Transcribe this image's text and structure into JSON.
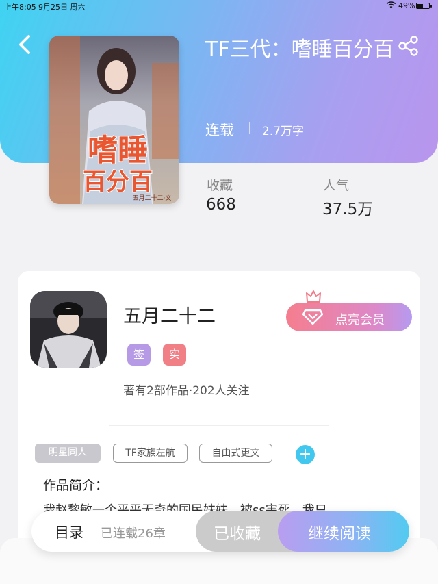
{
  "status_bar": {
    "time": "上午8:05",
    "date": "9月25日 周六",
    "battery": "49%",
    "battery_level": 0.49
  },
  "book": {
    "title": "TF三代：嗜睡百分百",
    "status": "连载",
    "words": "2.7万字",
    "cover_text": "嗜睡百分百",
    "cover_author": "五月二十二·文"
  },
  "stats": {
    "collect_label": "收藏",
    "collect_value": "668",
    "popularity_label": "人气",
    "popularity_value": "37.5万"
  },
  "author": {
    "name": "五月二十二",
    "badges": [
      "签",
      "实"
    ],
    "meta": "著有2部作品·202人关注",
    "vip_button": "点亮会员"
  },
  "tags": [
    "明星同人",
    "TF家族左航",
    "自由式更文"
  ],
  "intro": {
    "title": "作品简介：",
    "text": "我赵黎敏一个平平无奇的国民妹妹，被ss害死，我只"
  },
  "bottom_bar": {
    "toc_label": "目录",
    "toc_count": "已连载26章",
    "collected": "已收藏",
    "continue": "继续阅读"
  },
  "colors": {
    "header_start": "#3fd3f2",
    "header_end": "#b995ee",
    "badge_qian": "#b79ae6",
    "badge_shi": "#f17f86",
    "vip_start": "#f57e8e",
    "accent_blue": "#42c8ef"
  }
}
